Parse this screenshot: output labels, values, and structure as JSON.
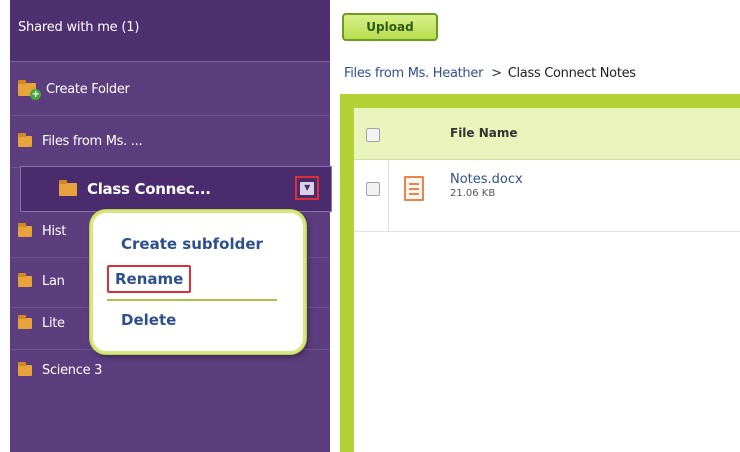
{
  "sidebar": {
    "shared_title": "Shared with me (1)",
    "create_folder": "Create Folder",
    "folders": [
      {
        "label": "Files from Ms. ...",
        "icon": "folder-icon"
      },
      {
        "label": "Class Connec...",
        "icon": "folder-icon",
        "selected": true
      },
      {
        "label": "Hist",
        "icon": "folder-icon"
      },
      {
        "label": "Lan",
        "icon": "folder-icon"
      },
      {
        "label": "Lite",
        "icon": "folder-icon"
      },
      {
        "label": "Science 3",
        "icon": "folder-icon"
      }
    ],
    "dropdown_icon": "chevron-down-icon"
  },
  "context_menu": {
    "create_subfolder": "Create subfolder",
    "rename": "Rename",
    "delete": "Delete"
  },
  "toolbar": {
    "upload_label": "Upload"
  },
  "breadcrumb": {
    "parent": "Files from Ms. Heather",
    "separator": ">",
    "current": "Class Connect Notes"
  },
  "file_table": {
    "header_file_name": "File Name",
    "rows": [
      {
        "name": "Notes.docx",
        "size": "21.06 KB",
        "icon": "document-icon"
      }
    ]
  },
  "colors": {
    "sidebar_bg": "#5c3d7e",
    "accent_green": "#b4d234",
    "link_blue": "#2f4f8f",
    "highlight_red": "#d9303a",
    "folder_orange": "#e8a33c"
  }
}
